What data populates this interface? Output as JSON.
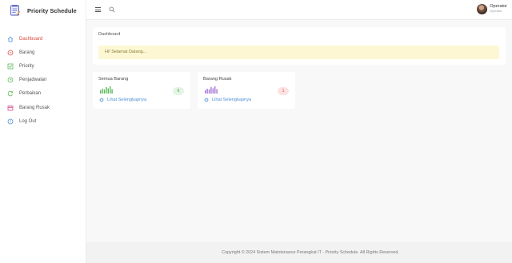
{
  "app": {
    "title": "Priority Schedule"
  },
  "sidebar": {
    "items": [
      {
        "label": "Dashboard",
        "icon": "home-icon",
        "active": true
      },
      {
        "label": "Barang",
        "icon": "box-icon",
        "active": false
      },
      {
        "label": "Priority",
        "icon": "check-icon",
        "active": false
      },
      {
        "label": "Penjadwalan",
        "icon": "clock-icon",
        "active": false
      },
      {
        "label": "Perbaikan",
        "icon": "refresh-icon",
        "active": false
      },
      {
        "label": "Barang Rusak",
        "icon": "calendar-icon",
        "active": false
      },
      {
        "label": "Log Out",
        "icon": "logout-icon",
        "active": false
      }
    ]
  },
  "topbar": {
    "user_name": "Operator",
    "user_role": "Operator"
  },
  "dashboard": {
    "title": "Dashboard",
    "welcome": "Hi! Selamat Datang..."
  },
  "cards": [
    {
      "title": "Semua Barang",
      "count": "6",
      "link": "Lihat Selengkapnya",
      "color": "#5cb85c",
      "badge_bg": "#e3f5e3"
    },
    {
      "title": "Barang Rusak",
      "count": "1",
      "link": "Lihat Selengkapnya",
      "color": "#a471d6",
      "badge_bg": "#fde2e2",
      "badge_fg": "#d9534f"
    }
  ],
  "footer": {
    "text": "Copyright © 2024 Sistem Maintenance Perangkat IT - Priority Schedule. All Rights Reserved."
  }
}
